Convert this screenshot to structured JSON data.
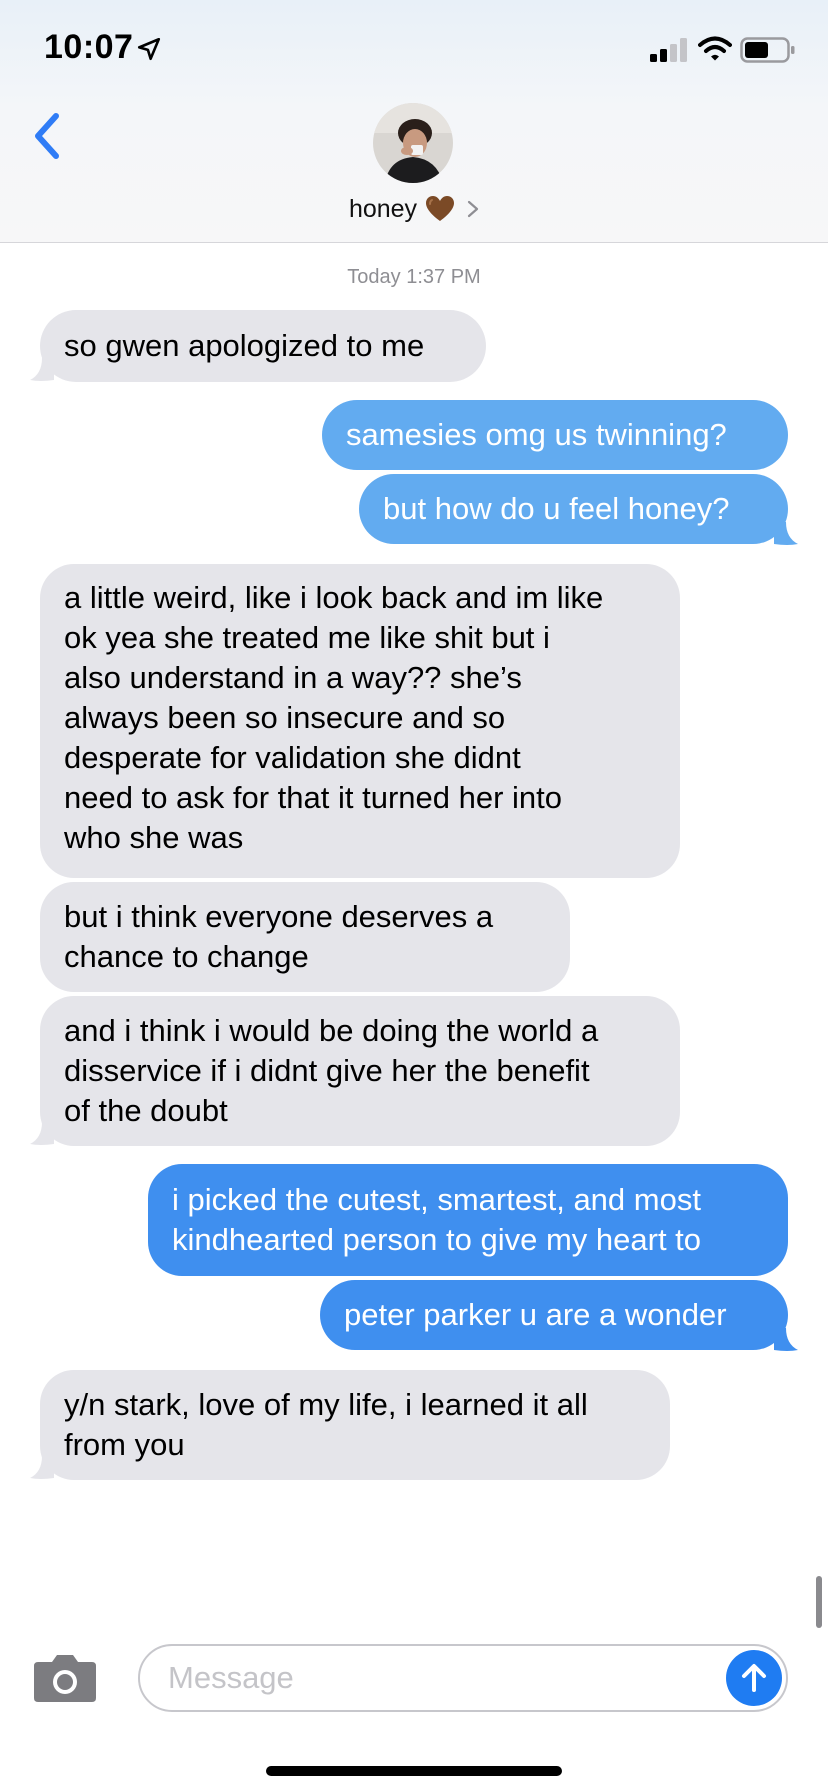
{
  "status_bar": {
    "time": "10:07",
    "location_icon": "location-arrow-icon",
    "signal_icon": "cellular-signal-icon",
    "wifi_icon": "wifi-icon",
    "battery_icon": "battery-icon"
  },
  "header": {
    "back_icon": "chevron-left-icon",
    "contact_name": "honey",
    "contact_emoji_icon": "brown-heart-icon",
    "details_icon": "chevron-right-icon"
  },
  "conversation": {
    "timestamp_day": "Today",
    "timestamp_time": "1:37 PM",
    "messages": [
      {
        "from": "them",
        "text": "so gwen apologized to me"
      },
      {
        "from": "me",
        "text": "samesies omg us twinning?"
      },
      {
        "from": "me",
        "text": "but how do u feel honey?"
      },
      {
        "from": "them",
        "text": "a little weird, like i look back and im like\nok yea she treated me like shit but i\nalso understand in a way?? she’s\nalways been so insecure and so\ndesperate for validation she didnt\nneed to ask for that it turned her into\nwho she was"
      },
      {
        "from": "them",
        "text": "but i think everyone deserves a\nchance to change"
      },
      {
        "from": "them",
        "text": "and i think i would be doing the world a\ndisservice if i didnt give her the benefit\nof the doubt"
      },
      {
        "from": "me",
        "text": "i picked the cutest, smartest, and most\nkindhearted person to give my heart to"
      },
      {
        "from": "me",
        "text": "peter parker u are a wonder"
      },
      {
        "from": "them",
        "text": "y/n stark, love of my life, i learned it all\nfrom you"
      }
    ]
  },
  "composer": {
    "camera_icon": "camera-icon",
    "placeholder": "Message",
    "send_icon": "arrow-up-icon"
  },
  "colors": {
    "incoming_bubble": "#e5e5ea",
    "outgoing_bubble": "#62abf0",
    "outgoing_bubble_dark": "#3f8fef",
    "accent": "#1f7cf2",
    "timestamp": "#8e8e93"
  }
}
